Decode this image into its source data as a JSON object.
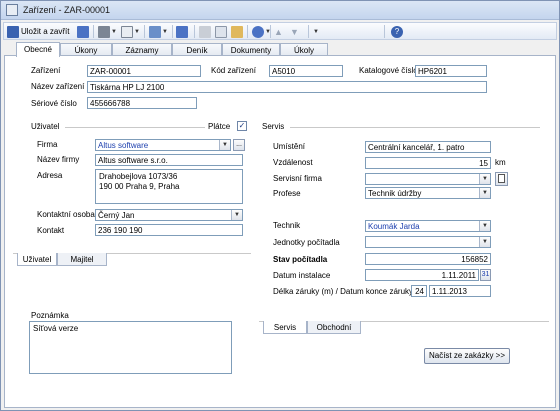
{
  "window": {
    "title": "Zařízení - ZAR-00001"
  },
  "toolbar": {
    "save_close_label": "Uložit a zavřít",
    "icons": [
      "save-icon",
      "copy-icon",
      "print-icon",
      "preview-icon",
      "attach-icon",
      "save-as-icon",
      "cut-icon",
      "copy-icon",
      "paste-icon",
      "undo-icon",
      "up-icon",
      "down-icon",
      "help-icon"
    ]
  },
  "tabs": [
    {
      "label": "Obecné",
      "active": true
    },
    {
      "label": "Úkony"
    },
    {
      "label": "Záznamy"
    },
    {
      "label": "Deník"
    },
    {
      "label": "Dokumenty"
    },
    {
      "label": "Úkoly"
    }
  ],
  "general": {
    "zarizeni_label": "Zařízení",
    "zarizeni_value": "ZAR-00001",
    "kod_label": "Kód zařízení",
    "kod_value": "A5010",
    "katalog_label": "Katalogové číslo",
    "katalog_value": "HP6201",
    "nazev_label": "Název zařízení",
    "nazev_value": "Tiskárna HP LJ 2100",
    "seriove_label": "Sériové číslo",
    "seriove_value": "455666788"
  },
  "uzivatel": {
    "section_label": "Uživatel",
    "platce_label": "Plátce",
    "platce_checked": "✓",
    "firma_label": "Firma",
    "firma_value": "Altus software",
    "ellipsis": "...",
    "nazev_firmy_label": "Název firmy",
    "nazev_firmy_value": "Altus software s.r.o.",
    "adresa_label": "Adresa",
    "adresa_value": "Drahobejlova 1073/36\n190 00 Praha 9, Praha",
    "kontaktni_osoba_label": "Kontaktní osoba",
    "kontaktni_osoba_value": "Černý Jan",
    "kontakt_label": "Kontakt",
    "kontakt_value": "236 190 190",
    "subtabs": [
      "Uživatel",
      "Majitel"
    ]
  },
  "poznamka": {
    "label": "Poznámka",
    "value": "Síťová verze"
  },
  "servis": {
    "section_label": "Servis",
    "umisteni_label": "Umístění",
    "umisteni_value": "Centrální kancelář, 1. patro",
    "vzdalenost_label": "Vzdálenost",
    "vzdalenost_value": "15",
    "vzdalenost_unit": "km",
    "servisni_firma_label": "Servisní firma",
    "servisni_firma_value": "",
    "profese_label": "Profese",
    "profese_value": "Technik údržby",
    "technik_label": "Technik",
    "technik_value": "Koumák Jarda",
    "jednotky_label": "Jednotky počítadla",
    "jednotky_value": "",
    "stav_label": "Stav počítadla",
    "stav_value": "156852",
    "datum_instalace_label": "Datum instalace",
    "datum_instalace_value": "1.11.2011",
    "calendar_day": "31",
    "zaruka_label": "Délka záruky (m) / Datum konce záruky",
    "zaruka_months": "24",
    "zaruka_date": "1.11.2013",
    "subtabs": [
      "Servis",
      "Obchodní"
    ],
    "load_button": "Načíst ze zakázky >>"
  }
}
